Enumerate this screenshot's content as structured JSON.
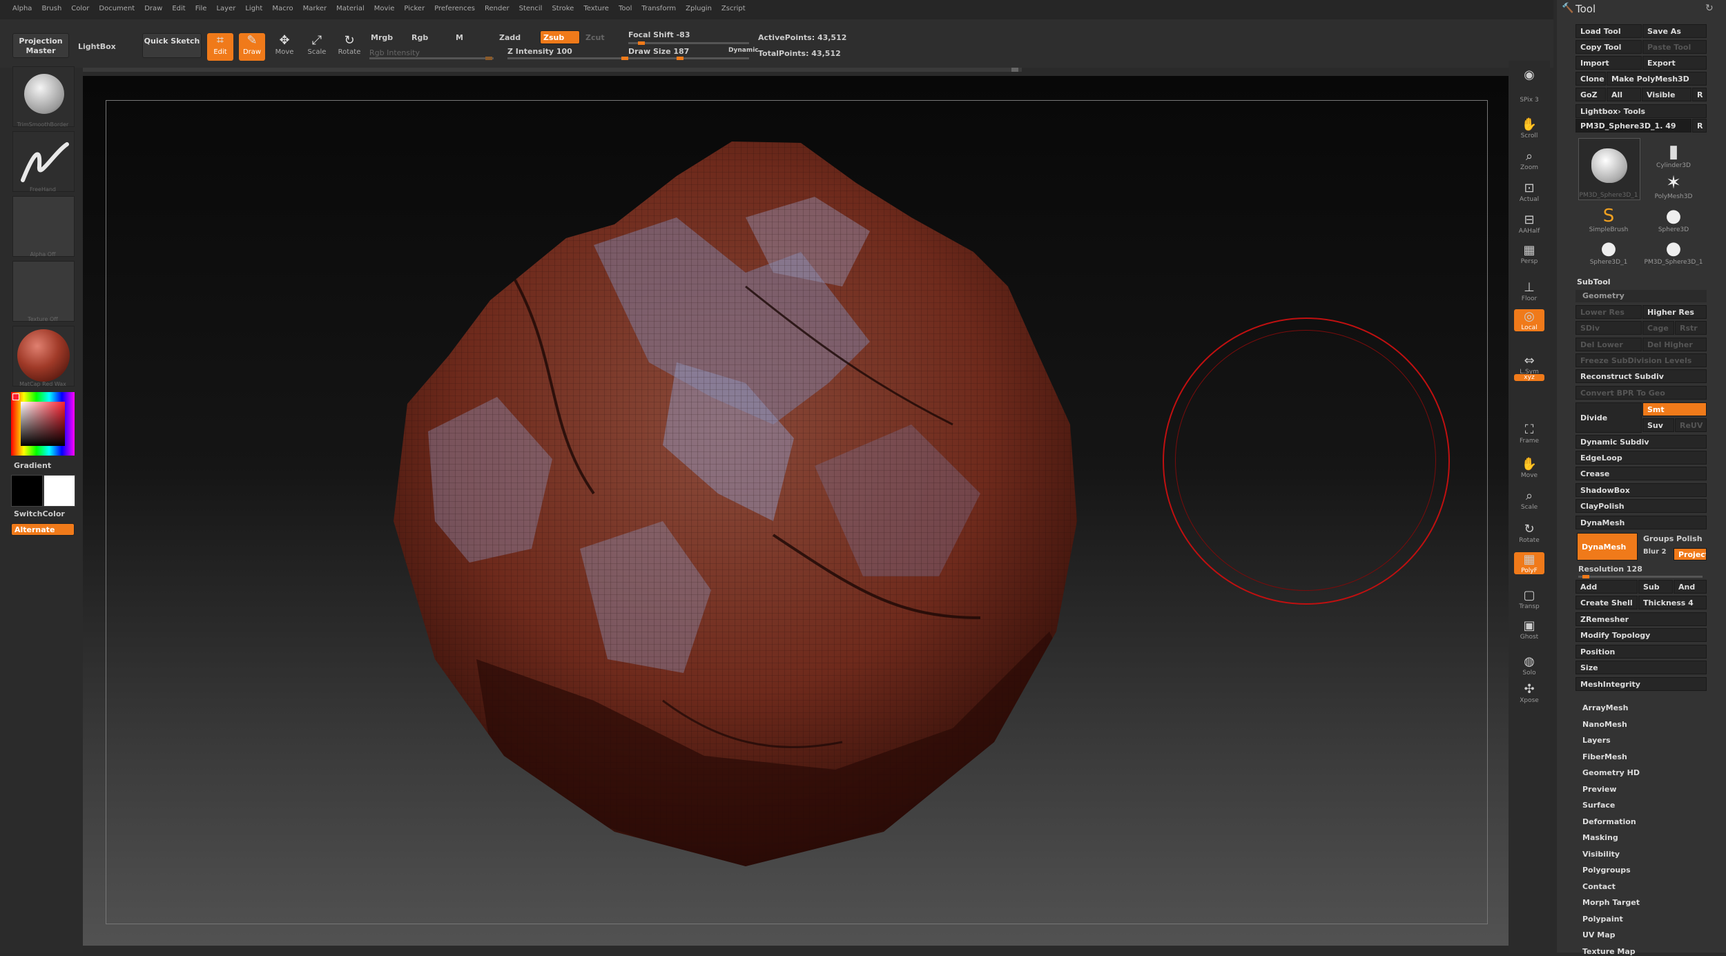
{
  "menu": [
    "Alpha",
    "Brush",
    "Color",
    "Document",
    "Draw",
    "Edit",
    "File",
    "Layer",
    "Light",
    "Macro",
    "Marker",
    "Material",
    "Movie",
    "Picker",
    "Preferences",
    "Render",
    "Stencil",
    "Stroke",
    "Texture",
    "Tool",
    "Transform",
    "Zplugin",
    "Zscript"
  ],
  "toolbar": {
    "projection_master": "Projection Master",
    "lightbox": "LightBox",
    "quick_sketch": "Quick Sketch",
    "edit": "Edit",
    "draw": "Draw",
    "move": "Move",
    "scale": "Scale",
    "rotate": "Rotate",
    "mrgb": "Mrgb",
    "rgb": "Rgb",
    "m": "M",
    "zadd": "Zadd",
    "zsub": "Zsub",
    "zcut": "Zcut",
    "rgb_intensity": "Rgb Intensity",
    "z_intensity_label": "Z Intensity",
    "z_intensity_value": "100",
    "focal_shift_label": "Focal Shift",
    "focal_shift_value": "-83",
    "draw_size_label": "Draw Size",
    "draw_size_value": "187",
    "dynamic": "Dynamic",
    "active_points": "ActivePoints: 43,512",
    "total_points": "TotalPoints: 43,512"
  },
  "left_shelf": {
    "brush_label": "TrimSmoothBorder",
    "stroke_label": "FreeHand",
    "alpha_label": "Alpha Off",
    "texture_label": "Texture Off",
    "material_label": "MatCap Red Wax",
    "gradient": "Gradient",
    "switch_color": "SwitchColor",
    "alternate": "Alternate"
  },
  "right_shelf": [
    {
      "name": "bpr-icon",
      "label": "",
      "glyph": "◉",
      "on": false
    },
    {
      "name": "spix-label",
      "label": "SPix 3",
      "glyph": "",
      "on": false
    },
    {
      "name": "scroll-icon",
      "label": "Scroll",
      "glyph": "✋",
      "on": false
    },
    {
      "name": "zoom-icon",
      "label": "Zoom",
      "glyph": "⌕",
      "on": false
    },
    {
      "name": "actual-icon",
      "label": "Actual",
      "glyph": "⊡",
      "on": false
    },
    {
      "name": "aahalf-icon",
      "label": "AAHalf",
      "glyph": "⊟",
      "on": false
    },
    {
      "name": "persp-icon",
      "label": "Persp",
      "glyph": "▦",
      "on": false
    },
    {
      "name": "floor-icon",
      "label": "Floor",
      "glyph": "⊥",
      "on": false
    },
    {
      "name": "local-icon",
      "label": "Local",
      "glyph": "◎",
      "on": true
    },
    {
      "name": "lsym-icon",
      "label": "L.Sym",
      "glyph": "⇔",
      "on": false
    },
    {
      "name": "xyz-icon",
      "label": "xyz",
      "glyph": "",
      "on": true
    },
    {
      "name": "frame-icon",
      "label": "Frame",
      "glyph": "⛶",
      "on": false
    },
    {
      "name": "move-icon",
      "label": "Move",
      "glyph": "✋",
      "on": false
    },
    {
      "name": "scale-icon",
      "label": "Scale",
      "glyph": "⌕",
      "on": false
    },
    {
      "name": "rotate-icon",
      "label": "Rotate",
      "glyph": "↻",
      "on": false
    },
    {
      "name": "polyf-icon",
      "label": "PolyF",
      "glyph": "▦",
      "on": true
    },
    {
      "name": "transp-icon",
      "label": "Transp",
      "glyph": "▢",
      "on": false
    },
    {
      "name": "ghost-icon",
      "label": "Ghost",
      "glyph": "▣",
      "on": false
    },
    {
      "name": "solo-icon",
      "label": "Solo",
      "glyph": "◍",
      "on": false
    },
    {
      "name": "xpose-icon",
      "label": "Xpose",
      "glyph": "✣",
      "on": false
    }
  ],
  "tool_panel": {
    "title": "Tool",
    "load_tool": "Load Tool",
    "save_as": "Save As",
    "copy_tool": "Copy Tool",
    "paste_tool": "Paste Tool",
    "import": "Import",
    "export": "Export",
    "clone": "Clone",
    "make_polymesh": "Make PolyMesh3D",
    "goz": "GoZ",
    "all": "All",
    "visible": "Visible",
    "r": "R",
    "lightbox_tools": "Lightbox› Tools",
    "current_tool": "PM3D_Sphere3D_1. 49",
    "tools": [
      {
        "name": "PM3D_Sphere3D_1",
        "glyph": "⬤"
      },
      {
        "name": "Cylinder3D",
        "glyph": "▮"
      },
      {
        "name": "PolyMesh3D",
        "glyph": "✶"
      },
      {
        "name": "SimpleBrush",
        "glyph": "S"
      },
      {
        "name": "Sphere3D",
        "glyph": "●"
      },
      {
        "name": "Sphere3D_1",
        "glyph": "●"
      },
      {
        "name": "PM3D_Sphere3D_1",
        "glyph": "●"
      }
    ],
    "subtool": "SubTool",
    "geometry": "Geometry",
    "lower_res": "Lower Res",
    "higher_res": "Higher Res",
    "sdiv": "SDiv",
    "cage": "Cage",
    "rstr": "Rstr",
    "del_lower": "Del Lower",
    "del_higher": "Del Higher",
    "freeze_subdivision_levels": "Freeze SubDivision Levels",
    "reconstruct_subdiv": "Reconstruct Subdiv",
    "convert_bpr": "Convert BPR To Geo",
    "divide": "Divide",
    "smt": "Smt",
    "suv": "Suv",
    "reuv": "ReUV",
    "dynamic_subdiv": "Dynamic Subdiv",
    "edgeloop": "EdgeLoop",
    "crease": "Crease",
    "shadowbox": "ShadowBox",
    "claypolish": "ClayPolish",
    "dynamesh_section": "DynaMesh",
    "dynamesh_btn": "DynaMesh",
    "groups": "Groups",
    "polish": "Polish",
    "blur": "Blur 2",
    "project": "Project",
    "resolution": "Resolution 128",
    "add": "Add",
    "sub": "Sub",
    "and": "And",
    "create_shell": "Create Shell",
    "thickness": "Thickness 4",
    "zremesher": "ZRemesher",
    "modify_topology": "Modify Topology",
    "position": "Position",
    "size": "Size",
    "meshintegrity": "MeshIntegrity",
    "sections": [
      "ArrayMesh",
      "NanoMesh",
      "Layers",
      "FiberMesh",
      "Geometry HD",
      "Preview",
      "Surface",
      "Deformation",
      "Masking",
      "Visibility",
      "Polygroups",
      "Contact",
      "Morph Target",
      "Polypaint",
      "UV Map",
      "Texture Map"
    ]
  }
}
